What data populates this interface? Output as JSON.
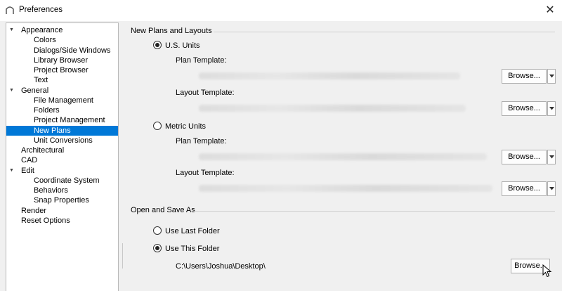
{
  "window": {
    "title": "Preferences",
    "close_glyph": "✕"
  },
  "tree": [
    {
      "label": "Appearance",
      "level": 0,
      "expanded": true
    },
    {
      "label": "Colors",
      "level": 1
    },
    {
      "label": "Dialogs/Side Windows",
      "level": 1
    },
    {
      "label": "Library Browser",
      "level": 1
    },
    {
      "label": "Project Browser",
      "level": 1
    },
    {
      "label": "Text",
      "level": 1
    },
    {
      "label": "General",
      "level": 0,
      "expanded": true
    },
    {
      "label": "File Management",
      "level": 1
    },
    {
      "label": "Folders",
      "level": 1
    },
    {
      "label": "Project Management",
      "level": 1
    },
    {
      "label": "New Plans",
      "level": 1,
      "selected": true
    },
    {
      "label": "Unit Conversions",
      "level": 1
    },
    {
      "label": "Architectural",
      "level": 0
    },
    {
      "label": "CAD",
      "level": 0
    },
    {
      "label": "Edit",
      "level": 0,
      "expanded": true
    },
    {
      "label": "Coordinate System",
      "level": 1
    },
    {
      "label": "Behaviors",
      "level": 1
    },
    {
      "label": "Snap Properties",
      "level": 1
    },
    {
      "label": "Render",
      "level": 0
    },
    {
      "label": "Reset Options",
      "level": 0
    }
  ],
  "new_plans": {
    "heading": "New Plans and Layouts",
    "us_units": {
      "label": "U.S. Units",
      "checked": true,
      "plan_template_label": "Plan Template:",
      "layout_template_label": "Layout Template:"
    },
    "metric_units": {
      "label": "Metric Units",
      "checked": false,
      "plan_template_label": "Plan Template:",
      "layout_template_label": "Layout Template:"
    },
    "browse_label": "Browse..."
  },
  "open_save": {
    "heading": "Open and Save As",
    "use_last_folder": {
      "label": "Use Last Folder",
      "checked": false
    },
    "use_this_folder": {
      "label": "Use This Folder",
      "checked": true
    },
    "folder_path": "C:\\Users\\Joshua\\Desktop\\",
    "browse_label": "Browse..."
  },
  "colors": {
    "selection": "#0078d7",
    "client_bg": "#f0f0f0"
  }
}
